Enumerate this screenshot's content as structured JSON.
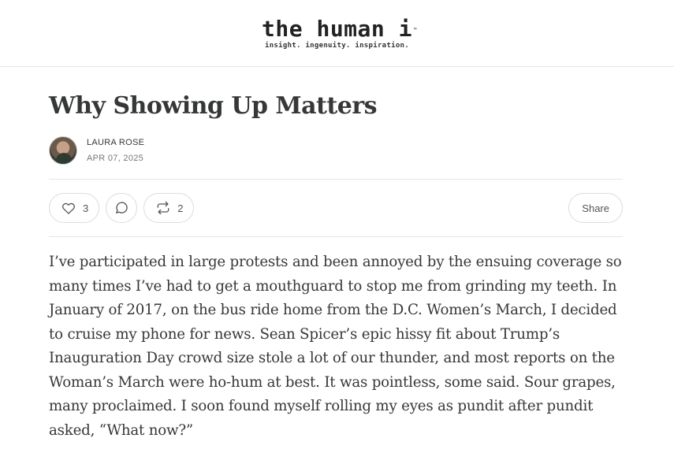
{
  "masthead": {
    "logo_title": "the human i",
    "logo_mark": "™",
    "logo_tagline": "insight. ingenuity. inspiration."
  },
  "post": {
    "title": "Why Showing Up Matters",
    "author": "LAURA ROSE",
    "date": "APR 07, 2025",
    "body": "I’ve participated in large protests and been annoyed by the ensuing coverage so many times I’ve had to get a mouthguard to stop me from grinding my teeth. In January of 2017, on the bus ride home from the D.C. Women’s March, I decided to cruise my phone for news. Sean Spicer’s epic hissy fit about Trump’s Inauguration Day crowd size stole a lot of our thunder, and most reports on the Woman’s March were ho-hum at best. It was pointless, some said. Sour grapes, many proclaimed. I soon found myself rolling my eyes as pundit after pundit asked, “What now?”"
  },
  "actions": {
    "like_count": "3",
    "restack_count": "2",
    "share_label": "Share",
    "icons": {
      "like": "heart-icon",
      "comment": "comment-bubble-icon",
      "restack": "restack-arrows-icon"
    }
  }
}
